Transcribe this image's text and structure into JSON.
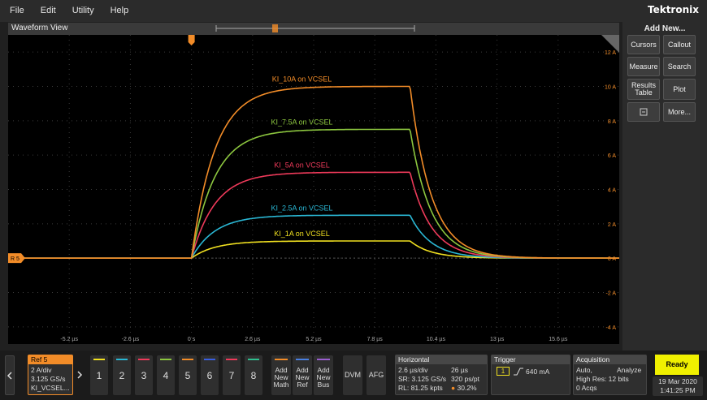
{
  "menu": {
    "items": [
      "File",
      "Edit",
      "Utility",
      "Help"
    ],
    "brand": "Tektronix"
  },
  "waveform_view": {
    "title": "Waveform View",
    "ref_label": "R 5",
    "y_ticks": [
      "12 A",
      "10 A",
      "8 A",
      "6 A",
      "4 A",
      "2 A",
      "0 A",
      "-2 A",
      "-4 A"
    ],
    "x_ticks": [
      "-5.2 µs",
      "-2.6 µs",
      "0 s",
      "2.6 µs",
      "5.2 µs",
      "7.8 µs",
      "10.4 µs",
      "13 µs",
      "15.6 µs"
    ],
    "chart_data": {
      "type": "line",
      "x_unit": "µs",
      "y_unit": "A",
      "xlim": [
        -7.8,
        18.2
      ],
      "ylim": [
        -5,
        13
      ],
      "series": [
        {
          "name": "KI_10A on VCSEL",
          "color": "#f28c28",
          "level": 10.0
        },
        {
          "name": "KI_7.5A on VCSEL",
          "color": "#8cc63f",
          "level": 7.5
        },
        {
          "name": "KI_5A on VCSEL",
          "color": "#ee3a5a",
          "level": 5.0
        },
        {
          "name": "KI_2.5A on VCSEL",
          "color": "#2ab7d4",
          "level": 2.5
        },
        {
          "name": "KI_1A on VCSEL",
          "color": "#f0e020",
          "level": 1.0
        }
      ]
    }
  },
  "side_panel": {
    "title": "Add New...",
    "buttons": [
      "Cursors",
      "Callout",
      "Measure",
      "Search",
      "Results Table",
      "Plot",
      "More..."
    ]
  },
  "bottom_bar": {
    "ref": {
      "title": "Ref 5",
      "line1": "2 A/div",
      "line2": "3.125 GS/s",
      "line3": "KI_VCSEL..."
    },
    "channels": [
      {
        "num": "1",
        "color": "#f0e020"
      },
      {
        "num": "2",
        "color": "#2ab7d4"
      },
      {
        "num": "3",
        "color": "#ee3a5a"
      },
      {
        "num": "4",
        "color": "#8cc63f"
      },
      {
        "num": "5",
        "color": "#f28c28"
      },
      {
        "num": "6",
        "color": "#3a5fe0"
      },
      {
        "num": "7",
        "color": "#ee3a5a"
      },
      {
        "num": "8",
        "color": "#2fbf8f"
      }
    ],
    "add_buttons": [
      {
        "label": "Add New Math",
        "color": "#f28c28"
      },
      {
        "label": "Add New Ref",
        "color": "#4a7fe0"
      },
      {
        "label": "Add New Bus",
        "color": "#9a5fd0"
      }
    ],
    "dvm": "DVM",
    "afg": "AFG",
    "horizontal": {
      "title": "Horizontal",
      "scale": "2.6 µs/div",
      "position": "26 µs",
      "sr": "SR: 3.125 GS/s",
      "pt": "320 ps/pt",
      "rl": "RL: 81.25 kpts",
      "pct": "30.2%"
    },
    "trigger": {
      "title": "Trigger",
      "channel": "1",
      "level": "640 mA"
    },
    "acquisition": {
      "title": "Acquisition",
      "mode": "Auto,",
      "analyze": "Analyze",
      "res": "High Res: 12 bits",
      "acqs": "0 Acqs"
    },
    "status": {
      "ready": "Ready",
      "date": "19 Mar 2020",
      "time": "1:41:25 PM"
    }
  }
}
